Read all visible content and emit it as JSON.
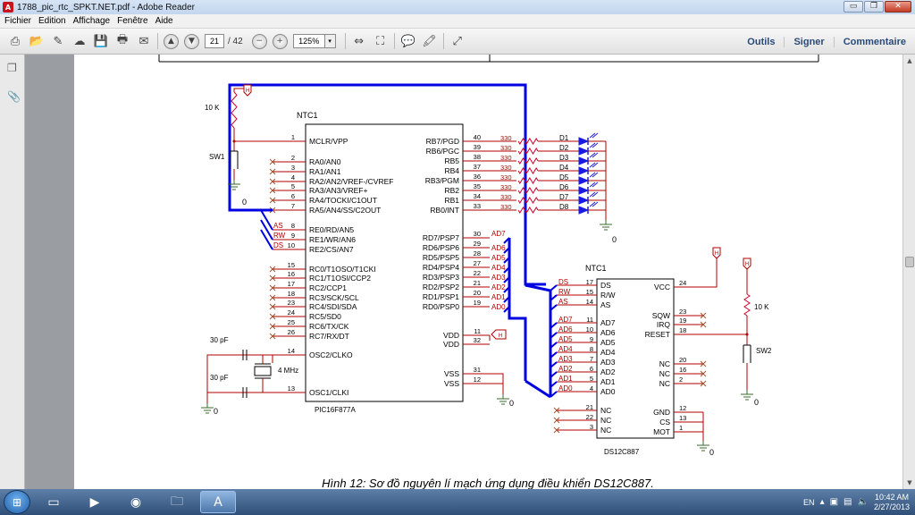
{
  "window": {
    "title": "1788_pic_rtc_SPKT.NET.pdf - Adobe Reader",
    "app_icon": "adobe-reader-icon",
    "buttons": {
      "minimize": "▭",
      "maximize": "❐",
      "close": "✕"
    }
  },
  "menu": {
    "items": [
      "Fichier",
      "Edition",
      "Affichage",
      "Fenêtre",
      "Aide"
    ]
  },
  "toolbar": {
    "page_current": "21",
    "page_total": "/ 42",
    "zoom": "125%",
    "zoom_dropdown": "▾",
    "zoom_out": "−",
    "zoom_in": "+",
    "prev_page": "▲",
    "next_page": "▼",
    "links": [
      "Outils",
      "Signer",
      "Commentaire"
    ]
  },
  "schematic": {
    "caption": "Hình 12: Sơ đồ nguyên lí mạch ứng dụng điều khiển DS12C887.",
    "pic": {
      "name": "NTC1",
      "part": "PIC16F877A",
      "left_pins": [
        {
          "num": "1",
          "name": "MCLR/VPP"
        },
        {
          "num": "2",
          "name": "RA0/AN0"
        },
        {
          "num": "3",
          "name": "RA1/AN1"
        },
        {
          "num": "4",
          "name": "RA2/AN2/VREF-/CVREF"
        },
        {
          "num": "5",
          "name": "RA3/AN3/VREF+"
        },
        {
          "num": "6",
          "name": "RA4/TOCKI/C1OUT"
        },
        {
          "num": "7",
          "name": "RA5/AN4/SS/C2OUT"
        },
        {
          "num": "8",
          "name": "RE0/RD/AN5"
        },
        {
          "num": "9",
          "name": "RE1/WR/AN6"
        },
        {
          "num": "10",
          "name": "RE2/CS/AN7"
        },
        {
          "num": "15",
          "name": "RC0/T1OSO/T1CKI"
        },
        {
          "num": "16",
          "name": "RC1/T1OSI/CCP2"
        },
        {
          "num": "17",
          "name": "RC2/CCP1"
        },
        {
          "num": "18",
          "name": "RC3/SCK/SCL"
        },
        {
          "num": "23",
          "name": "RC4/SDI/SDA"
        },
        {
          "num": "24",
          "name": "RC5/SD0"
        },
        {
          "num": "25",
          "name": "RC6/TX/CK"
        },
        {
          "num": "26",
          "name": "RC7/RX/DT"
        },
        {
          "num": "14",
          "name": "OSC2/CLKO"
        },
        {
          "num": "13",
          "name": "OSC1/CLKI"
        }
      ],
      "right_pins_b": [
        {
          "num": "40",
          "name": "RB7/PGD"
        },
        {
          "num": "39",
          "name": "RB6/PGC"
        },
        {
          "num": "38",
          "name": "RB5"
        },
        {
          "num": "37",
          "name": "RB4"
        },
        {
          "num": "36",
          "name": "RB3/PGM"
        },
        {
          "num": "35",
          "name": "RB2"
        },
        {
          "num": "34",
          "name": "RB1"
        },
        {
          "num": "33",
          "name": "RB0/INT"
        }
      ],
      "right_pins_d": [
        {
          "num": "30",
          "name": "RD7/PSP7",
          "net": "AD7"
        },
        {
          "num": "29",
          "name": "RD6/PSP6",
          "net": "AD6"
        },
        {
          "num": "28",
          "name": "RD5/PSP5",
          "net": "AD5"
        },
        {
          "num": "27",
          "name": "RD4/PSP4",
          "net": "AD4"
        },
        {
          "num": "22",
          "name": "RD3/PSP3",
          "net": "AD3"
        },
        {
          "num": "21",
          "name": "RD2/PSP2",
          "net": "AD2"
        },
        {
          "num": "20",
          "name": "RD1/PSP1",
          "net": "AD1"
        },
        {
          "num": "19",
          "name": "RD0/PSP0",
          "net": "AD0"
        }
      ],
      "right_pins_pwr": [
        {
          "num": "11",
          "name": "VDD"
        },
        {
          "num": "32",
          "name": "VDD"
        },
        {
          "num": "31",
          "name": "VSS"
        },
        {
          "num": "12",
          "name": "VSS"
        }
      ],
      "ctrl_nets": [
        "AS",
        "RW",
        "DS"
      ]
    },
    "leds": [
      "D1",
      "D2",
      "D3",
      "D4",
      "D5",
      "D6",
      "D7",
      "D8"
    ],
    "resistor_label": "330",
    "r_pullup": "10 K",
    "sw1": "SW1",
    "sw2": "SW2",
    "cap_label": "30 pF",
    "xtal_label": "4 MHz",
    "ground_label": "0",
    "power_tag": "H",
    "rtc": {
      "name": "NTC1",
      "part": "DS12C887",
      "left_pins": [
        {
          "num": "17",
          "name": "DS",
          "net": "DS"
        },
        {
          "num": "15",
          "name": "R/W",
          "net": "RW"
        },
        {
          "num": "14",
          "name": "AS",
          "net": "AS"
        },
        {
          "num": "11",
          "name": "AD7",
          "net": "AD7"
        },
        {
          "num": "10",
          "name": "AD6",
          "net": "AD6"
        },
        {
          "num": "9",
          "name": "AD5",
          "net": "AD5"
        },
        {
          "num": "8",
          "name": "AD4",
          "net": "AD4"
        },
        {
          "num": "7",
          "name": "AD3",
          "net": "AD3"
        },
        {
          "num": "6",
          "name": "AD2",
          "net": "AD2"
        },
        {
          "num": "5",
          "name": "AD1",
          "net": "AD1"
        },
        {
          "num": "4",
          "name": "AD0",
          "net": "AD0"
        },
        {
          "num": "21",
          "name": "NC"
        },
        {
          "num": "22",
          "name": "NC"
        },
        {
          "num": "3",
          "name": "NC"
        }
      ],
      "right_pins": [
        {
          "num": "24",
          "name": "VCC"
        },
        {
          "num": "23",
          "name": "SQW"
        },
        {
          "num": "19",
          "name": "IRQ"
        },
        {
          "num": "18",
          "name": "RESET"
        },
        {
          "num": "20",
          "name": "NC"
        },
        {
          "num": "16",
          "name": "NC"
        },
        {
          "num": "2",
          "name": "NC"
        },
        {
          "num": "12",
          "name": "GND"
        },
        {
          "num": "13",
          "name": "CS"
        },
        {
          "num": "1",
          "name": "MOT"
        }
      ]
    }
  },
  "taskbar": {
    "lang": "EN",
    "time": "10:42 AM",
    "date": "2/27/2013"
  },
  "colors": {
    "bus": "#0000e0",
    "wire": "#d0002c",
    "pin": "#b00000",
    "led": "#1a1ae0",
    "gnd": "#3a6b2a"
  }
}
